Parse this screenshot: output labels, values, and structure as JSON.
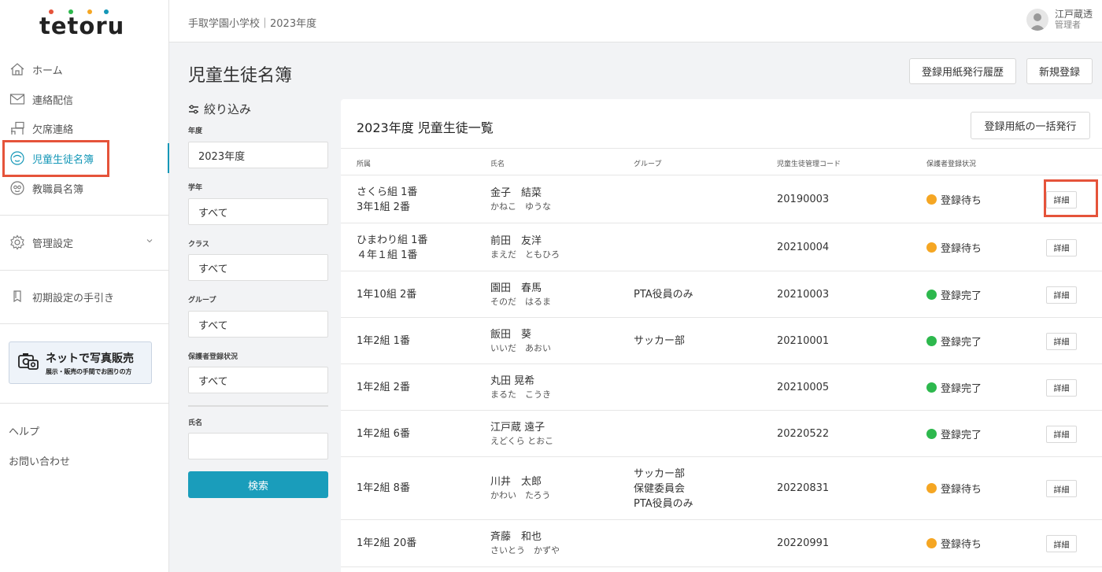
{
  "app": {
    "logo": "tetoru"
  },
  "sidebar": {
    "items": [
      {
        "label": "ホーム"
      },
      {
        "label": "連絡配信"
      },
      {
        "label": "欠席連絡"
      },
      {
        "label": "児童生徒名簿"
      },
      {
        "label": "教職員名簿"
      },
      {
        "label": "管理設定"
      },
      {
        "label": "初期設定の手引き"
      }
    ],
    "banner": {
      "line1": "ネットで写真販売",
      "line2": "展示・販売の手間でお困りの方"
    },
    "help": "ヘルプ",
    "contact": "お問い合わせ"
  },
  "header": {
    "school": "手取学園小学校｜2023年度",
    "user_name": "江戸蔵透",
    "user_role": "管理者"
  },
  "page": {
    "title": "児童生徒名簿",
    "history_button": "登録用紙発行履歴",
    "new_button": "新規登録"
  },
  "filter": {
    "title": "絞り込み",
    "year_label": "年度",
    "year_value": "2023年度",
    "grade_label": "学年",
    "grade_value": "すべて",
    "class_label": "クラス",
    "class_value": "すべて",
    "group_label": "グループ",
    "group_value": "すべて",
    "status_label": "保護者登録状況",
    "status_value": "すべて",
    "name_label": "氏名",
    "name_value": "",
    "search_button": "検索"
  },
  "list": {
    "title": "2023年度 児童生徒一覧",
    "bulk_button": "登録用紙の一括発行",
    "headers": [
      "所属",
      "氏名",
      "グループ",
      "児童生徒管理コード",
      "保護者登録状況"
    ],
    "detail_label": "詳細",
    "rows": [
      {
        "aff1": "さくら組 1番",
        "aff2": "3年1組 2番",
        "name": "金子　結菜",
        "furi": "かねこ　ゆうな",
        "groups": [],
        "code": "20190003",
        "status": "登録待ち",
        "status_color": "#f5a623"
      },
      {
        "aff1": "ひまわり組 1番",
        "aff2": "４年１組 1番",
        "name": "前田　友洋",
        "furi": "まえだ　ともひろ",
        "groups": [],
        "code": "20210004",
        "status": "登録待ち",
        "status_color": "#f5a623"
      },
      {
        "aff1": "1年10組 2番",
        "aff2": "",
        "name": "園田　春馬",
        "furi": "そのだ　はるま",
        "groups": [
          "PTA役員のみ"
        ],
        "code": "20210003",
        "status": "登録完了",
        "status_color": "#2db84d"
      },
      {
        "aff1": "1年2組 1番",
        "aff2": "",
        "name": "飯田　葵",
        "furi": "いいだ　あおい",
        "groups": [
          "サッカー部"
        ],
        "code": "20210001",
        "status": "登録完了",
        "status_color": "#2db84d"
      },
      {
        "aff1": "1年2組 2番",
        "aff2": "",
        "name": "丸田 晃希",
        "furi": "まるた　こうき",
        "groups": [],
        "code": "20210005",
        "status": "登録完了",
        "status_color": "#2db84d"
      },
      {
        "aff1": "1年2組 6番",
        "aff2": "",
        "name": "江戸蔵 遠子",
        "furi": "えどくら とおこ",
        "groups": [],
        "code": "20220522",
        "status": "登録完了",
        "status_color": "#2db84d"
      },
      {
        "aff1": "1年2組 8番",
        "aff2": "",
        "name": "川井　太郎",
        "furi": "かわい　たろう",
        "groups": [
          "サッカー部",
          "保健委員会",
          "PTA役員のみ"
        ],
        "code": "20220831",
        "status": "登録待ち",
        "status_color": "#f5a623"
      },
      {
        "aff1": "1年2組 20番",
        "aff2": "",
        "name": "斉藤　和也",
        "furi": "さいとう　かずや",
        "groups": [],
        "code": "20220991",
        "status": "登録待ち",
        "status_color": "#f5a623"
      }
    ]
  },
  "colors": {
    "accent": "#1497b7",
    "highlight": "#e5533a",
    "pending": "#f5a623",
    "done": "#2db84d"
  }
}
